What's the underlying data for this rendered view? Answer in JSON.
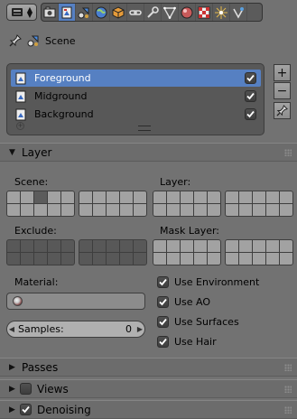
{
  "toolbar": {
    "editor_type_icon": "properties-editor-icon",
    "tabs": [
      {
        "icon": "render-icon"
      },
      {
        "icon": "render-layers-icon",
        "active": true
      },
      {
        "icon": "scene-icon"
      },
      {
        "icon": "world-icon"
      },
      {
        "icon": "object-icon"
      },
      {
        "icon": "constraints-icon"
      },
      {
        "icon": "modifiers-icon"
      },
      {
        "icon": "data-icon"
      },
      {
        "icon": "material-icon"
      },
      {
        "icon": "texture-icon"
      },
      {
        "icon": "particles-icon"
      },
      {
        "icon": "physics-icon"
      }
    ]
  },
  "context": {
    "label": "Scene",
    "pin_icon": "pin-icon",
    "scene_icon": "scene-icon"
  },
  "layers_list": {
    "items": [
      {
        "label": "Foreground",
        "checked": true,
        "selected": true
      },
      {
        "label": "Midground",
        "checked": true
      },
      {
        "label": "Background",
        "checked": true
      }
    ],
    "add_label": "+",
    "remove_label": "−"
  },
  "layer_panel": {
    "title": "Layer",
    "scene_label": "Scene:",
    "layer_label": "Layer:",
    "exclude_label": "Exclude:",
    "mask_layer_label": "Mask Layer:",
    "material_label": "Material:",
    "samples_label": "Samples:",
    "samples_value": "0",
    "options": [
      {
        "label": "Use Environment",
        "checked": true
      },
      {
        "label": "Use AO",
        "checked": true
      },
      {
        "label": "Use Surfaces",
        "checked": true
      },
      {
        "label": "Use Hair",
        "checked": true
      }
    ]
  },
  "panels": {
    "passes": "Passes",
    "views": "Views",
    "views_checked": false,
    "denoising": "Denoising",
    "denoising_checked": true
  },
  "colors": {
    "background": "#727272",
    "selection": "#5680c2",
    "panel_header": "#6c6c6c"
  }
}
